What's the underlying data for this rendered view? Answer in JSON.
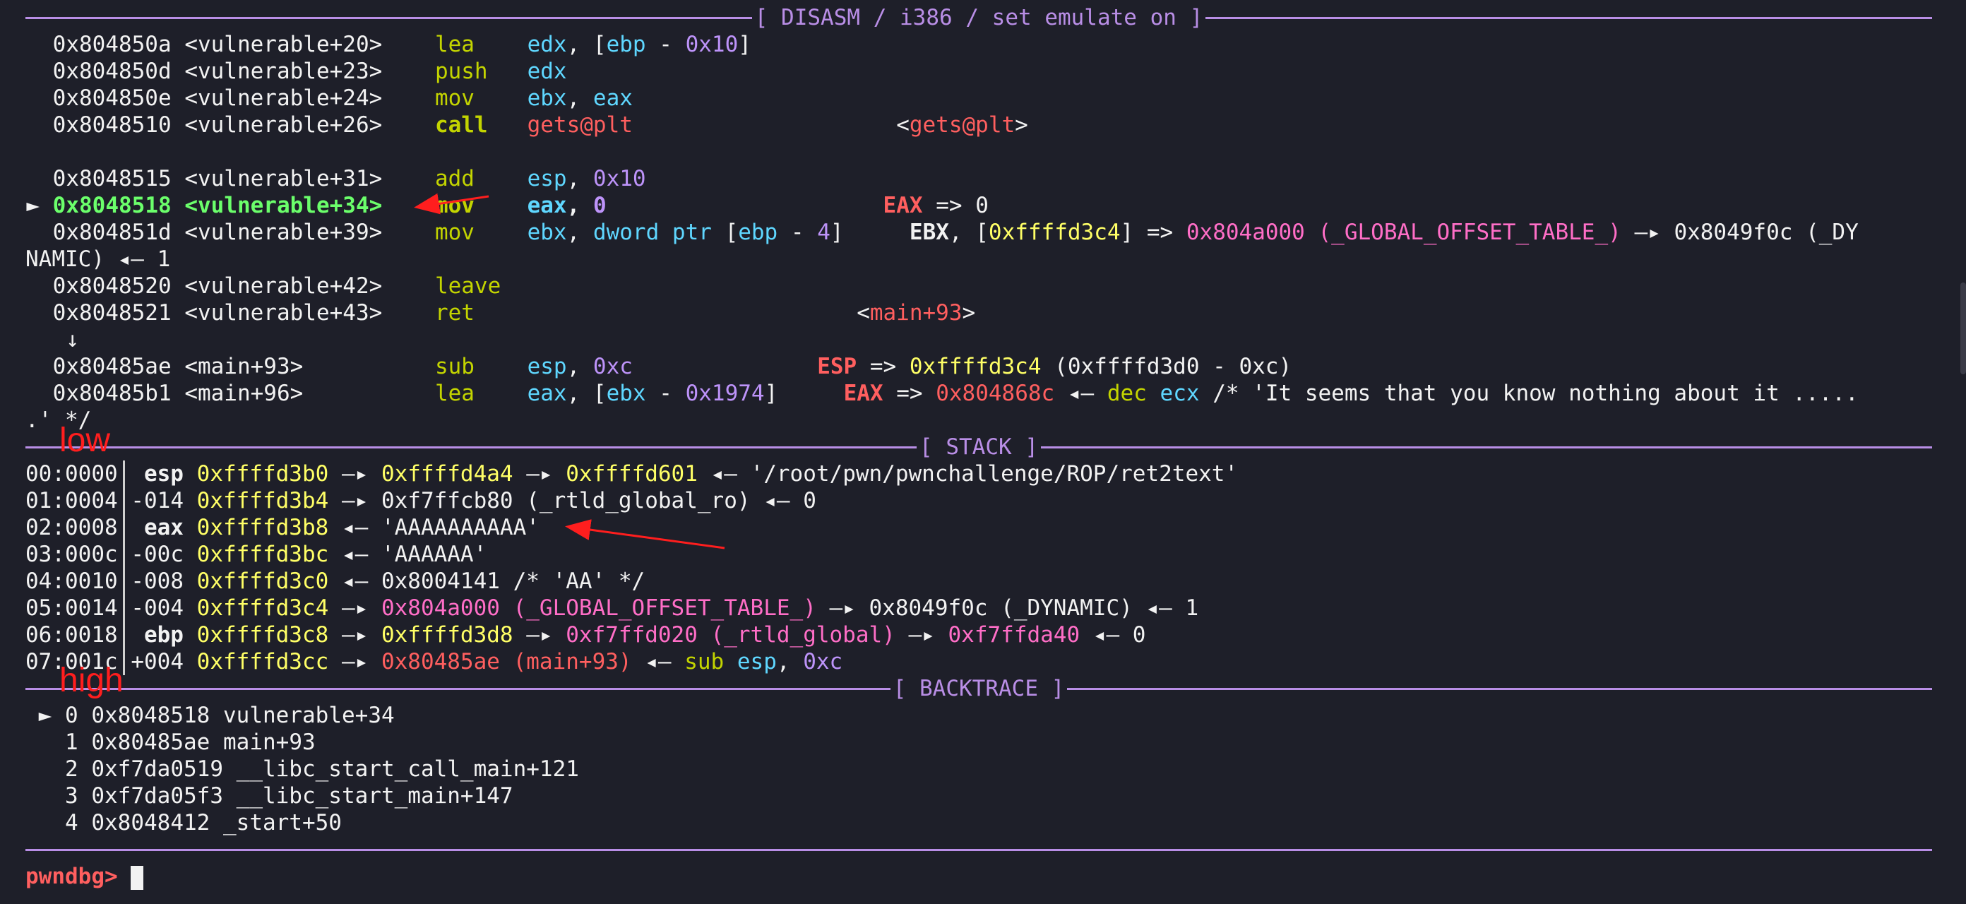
{
  "headers": {
    "disasm": "[ DISASM / i386 / set emulate on ]",
    "stack": "[ STACK ]",
    "backtrace": "[ BACKTRACE ]"
  },
  "disasm": {
    "r1": {
      "addr": "0x804850a",
      "sym": "<vulnerable+20>",
      "mn": "lea",
      "op1": "edx",
      "rest_a": ", [",
      "reg2": "ebp",
      "rest_b": " - ",
      "num": "0x10",
      "rest_c": "]"
    },
    "r2": {
      "addr": "0x804850d",
      "sym": "<vulnerable+23>",
      "mn": "push",
      "op1": "edx"
    },
    "r3": {
      "addr": "0x804850e",
      "sym": "<vulnerable+24>",
      "mn": "mov",
      "op1": "ebx",
      "sep": ", ",
      "op2": "eax"
    },
    "r4": {
      "addr": "0x8048510",
      "sym": "<vulnerable+26>",
      "mn": "call",
      "op1": "gets@plt",
      "ann_open": "<",
      "ann": "gets@plt",
      "ann_close": ">"
    },
    "r5": {
      "addr": "0x8048515",
      "sym": "<vulnerable+31>",
      "mn": "add",
      "op1": "esp",
      "sep": ", ",
      "op2": "0x10"
    },
    "r6": {
      "marker": "►",
      "addr": "0x8048518",
      "sym": "<vulnerable+34>",
      "mn": "mov",
      "op1": "eax",
      "sep": ", ",
      "op2": "0",
      "reg": "EAX",
      "arrow": " => ",
      "val": "0"
    },
    "r7": {
      "addr": "0x804851d",
      "sym": "<vulnerable+39>",
      "mn": "mov",
      "op1": "ebx",
      "sep": ", ",
      "op2": "dword ptr",
      "br1": " [",
      "reg2": "ebp",
      "minus": " - ",
      "num": "4",
      "br2": "]",
      "reg": "EBX",
      "a1": ", [",
      "p1": "0xffffd3c4",
      "a2": "] => ",
      "p2": "0x804a000 (_GLOBAL_OFFSET_TABLE_)",
      "a3": " —▸ ",
      "p3": "0x8049f0c (_DY"
    },
    "r7b": {
      "text": "NAMIC) ◂— 1"
    },
    "r8": {
      "addr": "0x8048520",
      "sym": "<vulnerable+42>",
      "mn": "leave"
    },
    "r9": {
      "addr": "0x8048521",
      "sym": "<vulnerable+43>",
      "mn": "ret",
      "ann_open": "<",
      "ann": "main+93",
      "ann_close": ">"
    },
    "down_arrow": "↓",
    "r10": {
      "addr": "0x80485ae",
      "sym": "<main+93>",
      "mn": "sub",
      "op1": "esp",
      "sep": ", ",
      "op2": "0xc",
      "reg": "ESP",
      "arrow": " => ",
      "p1": "0xffffd3c4",
      "rest": " (0xffffd3d0 - 0xc)"
    },
    "r11": {
      "addr": "0x80485b1",
      "sym": "<main+96>",
      "mn": "lea",
      "op1": "eax",
      "a1": ", [",
      "reg2": "ebx",
      "minus": " - ",
      "num": "0x1974",
      "br": "]",
      "reg": "EAX",
      "arrow": " => ",
      "p1": "0x804868c",
      "a2": " ◂— ",
      "mn2": "dec",
      "reg3": " ecx",
      "cmt": " /* 'It seems that you know nothing about it ....."
    },
    "r11b": {
      "text": ".' */"
    }
  },
  "stack": [
    {
      "idx": "00:0000",
      "reg": "esp",
      "addr": "0xffffd3b0",
      "a1": " —▸ ",
      "p1": "0xffffd4a4",
      "a2": " —▸ ",
      "p2": "0xffffd601",
      "a3": " ◂— ",
      "tail": "'/root/pwn/pwnchallenge/ROP/ret2text'"
    },
    {
      "idx": "01:0004",
      "reg": "-014",
      "addr": "0xffffd3b4",
      "a1": " —▸ ",
      "tail": "0xf7ffcb80 (_rtld_global_ro) ◂— 0"
    },
    {
      "idx": "02:0008",
      "reg": "eax",
      "addr": "0xffffd3b8",
      "a1": " ◂— ",
      "tail": "'AAAAAAAAAA'"
    },
    {
      "idx": "03:000c",
      "reg": "-00c",
      "addr": "0xffffd3bc",
      "a1": " ◂— ",
      "tail": "'AAAAAA'"
    },
    {
      "idx": "04:0010",
      "reg": "-008",
      "addr": "0xffffd3c0",
      "a1": " ◂— ",
      "tail": "0x8004141 /* 'AA' */"
    },
    {
      "idx": "05:0014",
      "reg": "-004",
      "addr": "0xffffd3c4",
      "a1": " —▸ ",
      "p1": "0x804a000 (_GLOBAL_OFFSET_TABLE_)",
      "a2": " —▸ ",
      "tail": "0x8049f0c (_DYNAMIC) ◂— 1"
    },
    {
      "idx": "06:0018",
      "reg": "ebp",
      "addr": "0xffffd3c8",
      "a1": " —▸ ",
      "p1": "0xffffd3d8",
      "a2": " —▸ ",
      "p2": "0xf7ffd020 (_rtld_global)",
      "a3": " —▸ ",
      "p3": "0xf7ffda40",
      "tail": " ◂— 0"
    },
    {
      "idx": "07:001c",
      "reg": "+004",
      "addr": "0xffffd3cc",
      "a1": " —▸ ",
      "p1": "0x80485ae (main+93)",
      "a2": " ◂— ",
      "mn": "sub",
      "op1": " esp",
      "sep": ", ",
      "op2": "0xc"
    }
  ],
  "backtrace": [
    {
      "marker": "►",
      "n": "0",
      "addr": "0x8048518",
      "fn": "vulnerable+34"
    },
    {
      "marker": "",
      "n": "1",
      "addr": "0x80485ae",
      "fn": "main+93"
    },
    {
      "marker": "",
      "n": "2",
      "addr": "0xf7da0519",
      "fn": "__libc_start_call_main+121"
    },
    {
      "marker": "",
      "n": "3",
      "addr": "0xf7da05f3",
      "fn": "__libc_start_main+147"
    },
    {
      "marker": "",
      "n": "4",
      "addr": "0x8048412",
      "fn": "_start+50"
    }
  ],
  "prompt": "pwndbg>",
  "annotations": {
    "low": "low",
    "high": "high"
  },
  "colors": {
    "accent": "#b98ee6",
    "mnemonic": "#c3d400",
    "register": "#5fd7ff",
    "number": "#bd93f9",
    "pointer": "#ffff66",
    "heap": "#ff6ec7",
    "code": "#ff5f5f",
    "current": "#6bff6b"
  }
}
